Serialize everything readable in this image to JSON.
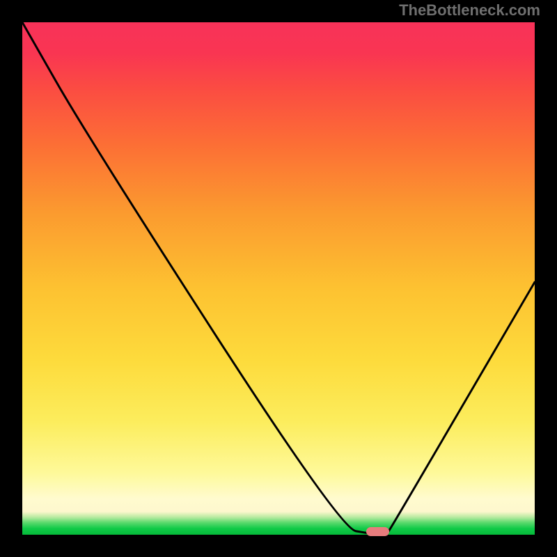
{
  "watermark": "TheBottleneck.com",
  "colors": {
    "frame_bg": "#000000",
    "curve": "#000000",
    "marker": "#e77c7d"
  },
  "chart_data": {
    "type": "line",
    "title": "",
    "xlabel": "",
    "ylabel": "",
    "xlim": [
      0,
      100
    ],
    "ylim": [
      0,
      100
    ],
    "grid": false,
    "legend": false,
    "series": [
      {
        "name": "bottleneck-curve",
        "x": [
          0,
          12.9,
          62.1,
          68.1,
          68.9,
          71.1,
          71.9,
          100
        ],
        "values": [
          100,
          77.4,
          1.2,
          0.2,
          0.2,
          0.2,
          1.2,
          49.3
        ]
      }
    ],
    "marker": {
      "x": 69.4,
      "y": 0.6
    },
    "background_gradient": [
      {
        "stop": 0.0,
        "color": "#06bb3a"
      },
      {
        "stop": 0.012,
        "color": "#0fca47"
      },
      {
        "stop": 0.024,
        "color": "#5dda6e"
      },
      {
        "stop": 0.034,
        "color": "#b7eaa0"
      },
      {
        "stop": 0.045,
        "color": "#fef7cd"
      },
      {
        "stop": 0.07,
        "color": "#fffbcf"
      },
      {
        "stop": 0.12,
        "color": "#fef99a"
      },
      {
        "stop": 0.22,
        "color": "#fced5d"
      },
      {
        "stop": 0.34,
        "color": "#fddb3c"
      },
      {
        "stop": 0.48,
        "color": "#fdc231"
      },
      {
        "stop": 0.63,
        "color": "#fb9a2f"
      },
      {
        "stop": 0.76,
        "color": "#fc6f35"
      },
      {
        "stop": 0.87,
        "color": "#fb4c42"
      },
      {
        "stop": 0.94,
        "color": "#f93552"
      },
      {
        "stop": 1.0,
        "color": "#f83259"
      }
    ]
  }
}
